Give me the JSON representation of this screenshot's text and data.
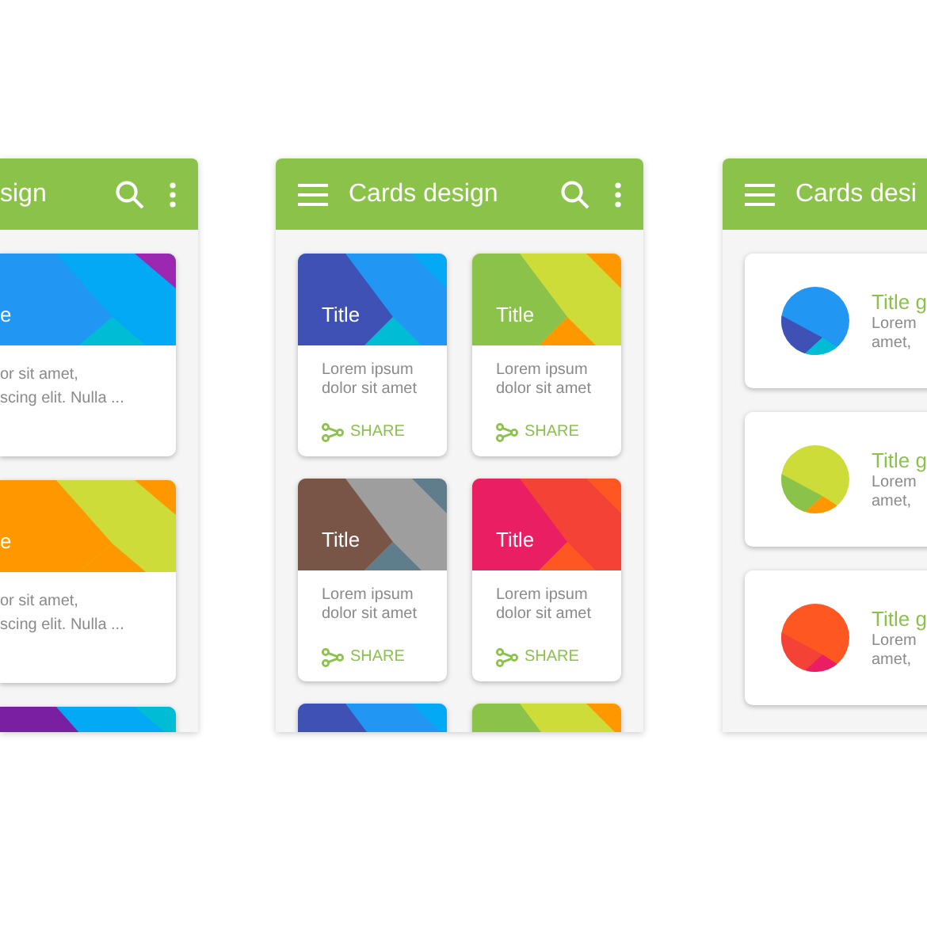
{
  "panels": [
    {
      "kind": "partial-list",
      "title": "sign",
      "search_icon": true,
      "more_icon": true,
      "cards": [
        {
          "kind": "card",
          "title": "e",
          "lines": [
            "or sit amet,",
            "scing elit. Nulla ..."
          ]
        },
        {
          "kind": "card",
          "title": "e",
          "lines": [
            "or sit amet,",
            "scing elit. Nulla ..."
          ]
        },
        {
          "kind": "picture"
        }
      ]
    },
    {
      "kind": "grid",
      "title": "Cards design",
      "menu_icon": true,
      "search_icon": true,
      "more_icon": true,
      "cards": [
        {
          "kind": "card",
          "title": "Title",
          "text": "Lorem ipsum dolor sit amet",
          "action": "SHARE"
        },
        {
          "kind": "card",
          "title": "Title",
          "text": "Lorem ipsum dolor sit amet",
          "action": "SHARE"
        },
        {
          "kind": "card",
          "title": "Title",
          "text": "Lorem ipsum dolor sit amet",
          "action": "SHARE"
        },
        {
          "kind": "card",
          "title": "Title",
          "text": "Lorem ipsum dolor sit amet",
          "action": "SHARE"
        },
        {
          "kind": "picture"
        },
        {
          "kind": "picture"
        }
      ]
    },
    {
      "kind": "avatar-list",
      "title": "Cards desi",
      "menu_icon": true,
      "cards": [
        {
          "kind": "card",
          "title": "Title g",
          "lines": [
            "Lorem",
            "amet,"
          ]
        },
        {
          "kind": "card",
          "title": "Title g",
          "lines": [
            "Lorem",
            "amet,"
          ]
        },
        {
          "kind": "card",
          "title": "Title g",
          "lines": [
            "Lorem",
            "amet,"
          ]
        }
      ]
    }
  ]
}
